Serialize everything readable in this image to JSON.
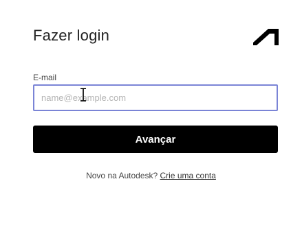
{
  "login": {
    "title": "Fazer login",
    "email_label": "E-mail",
    "email_placeholder": "name@example.com",
    "email_value": "",
    "next_button": "Avançar",
    "signup_prompt": "Novo na Autodesk?",
    "signup_link": "Crie uma conta"
  },
  "icons": {
    "logo": "autodesk-logo-icon",
    "cursor": "text-cursor-icon"
  },
  "colors": {
    "button_bg": "#000000",
    "button_text": "#ffffff",
    "input_focus_border": "#7a84d6",
    "title_text": "#222222"
  }
}
